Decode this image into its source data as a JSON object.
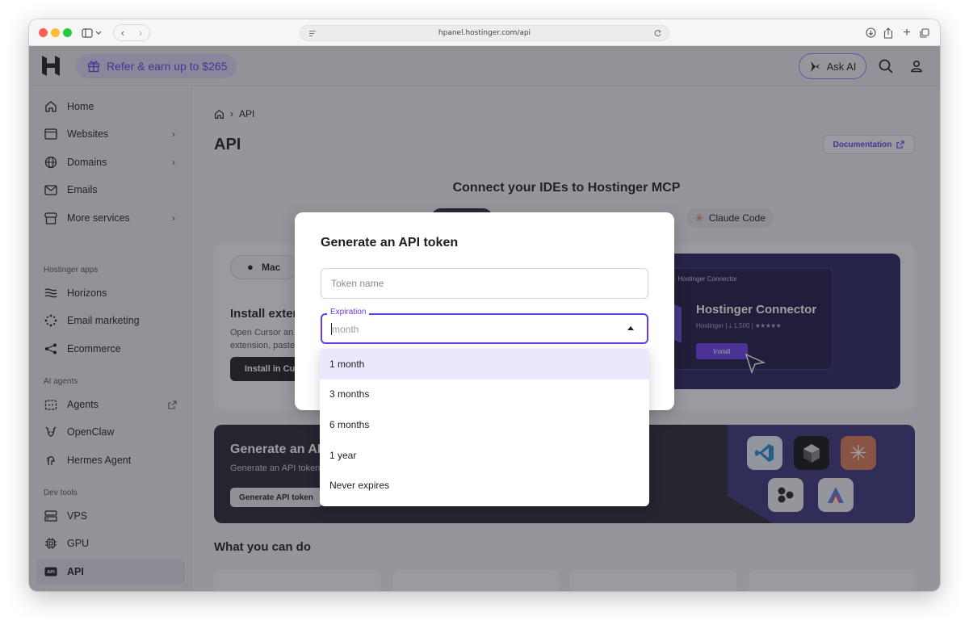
{
  "browser": {
    "url": "hpanel.hostinger.com/api",
    "traffic_colors": [
      "#fe5f57",
      "#febc2e",
      "#28c840"
    ]
  },
  "header": {
    "refer_label": "Refer & earn up to $265",
    "ask_ai_label": "Ask AI"
  },
  "sidebar": {
    "items": [
      {
        "label": "Home",
        "icon": "home-icon",
        "has_chevron": false
      },
      {
        "label": "Websites",
        "icon": "browser-window-icon",
        "has_chevron": true
      },
      {
        "label": "Domains",
        "icon": "globe-icon",
        "has_chevron": true
      },
      {
        "label": "Emails",
        "icon": "mail-icon",
        "has_chevron": false
      },
      {
        "label": "More services",
        "icon": "storefront-icon",
        "has_chevron": true
      }
    ],
    "section_apps": "Hostinger apps",
    "apps": [
      {
        "label": "Horizons",
        "icon": "horizons-icon"
      },
      {
        "label": "Email marketing",
        "icon": "sparkle-dots-icon"
      },
      {
        "label": "Ecommerce",
        "icon": "share-nodes-icon"
      }
    ],
    "section_agents": "AI agents",
    "agents": [
      {
        "label": "Agents",
        "icon": "agent-icon",
        "external": true
      },
      {
        "label": "OpenClaw",
        "icon": "claw-icon"
      },
      {
        "label": "Hermes Agent",
        "icon": "hermes-icon"
      }
    ],
    "section_dev": "Dev tools",
    "dev": [
      {
        "label": "VPS",
        "icon": "server-icon"
      },
      {
        "label": "GPU",
        "icon": "chip-icon"
      },
      {
        "label": "API",
        "icon": "api-icon",
        "active": true
      }
    ]
  },
  "main": {
    "breadcrumb_current": "API",
    "title": "API",
    "documentation_label": "Documentation",
    "mcp_title": "Connect your IDEs to Hostinger MCP",
    "claude_tab": "Claude Code",
    "mac_tab": "Mac",
    "install_title": "Install exten",
    "install_desc": "Open Cursor an extension, paste",
    "install_button": "Install in Cu",
    "connector_caption": "on: Hostinger Connector",
    "connector_title": "Hostinger Connector",
    "connector_meta": "Hostinger | ⤓ 1,500 | ★★★★★",
    "connector_install": "Install",
    "generate_title": "Generate an AP",
    "generate_desc": "Generate an API token",
    "generate_button": "Generate API token",
    "what_title": "What you can do"
  },
  "modal": {
    "title": "Generate an API token",
    "token_placeholder": "Token name",
    "token_value": "",
    "expiration_label": "Expiration",
    "expiration_value": "month",
    "options": [
      "1 month",
      "3 months",
      "6 months",
      "1 year",
      "Never expires"
    ],
    "selected_index": 0
  },
  "colors": {
    "accent": "#673de6",
    "dark": "#1d1e20"
  }
}
